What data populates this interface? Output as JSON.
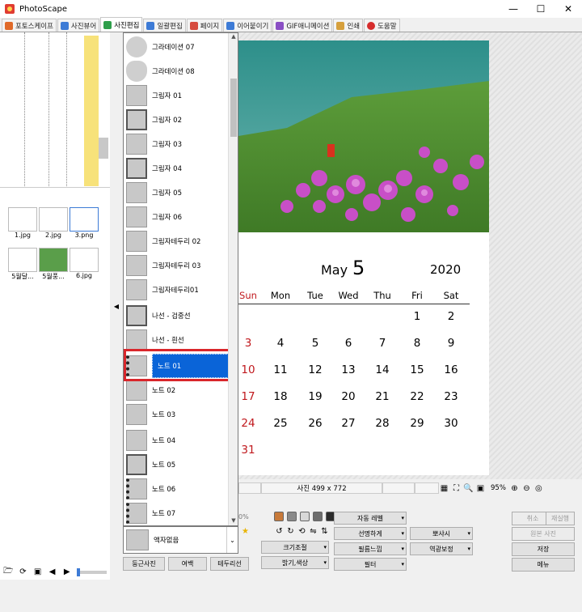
{
  "window": {
    "title": "PhotoScape",
    "minimize": "—",
    "maximize": "☐",
    "close": "✕"
  },
  "tabs": [
    {
      "label": "포토스케이프",
      "color": "#e06a2a"
    },
    {
      "label": "사진뷰어",
      "color": "#3d7bd6"
    },
    {
      "label": "사진편집",
      "color": "#2e9e4a"
    },
    {
      "label": "일괄편집",
      "color": "#3d7bd6"
    },
    {
      "label": "페이지",
      "color": "#d64a3d"
    },
    {
      "label": "이어붙이기",
      "color": "#3d7bd6"
    },
    {
      "label": "GIF애니메이션",
      "color": "#8a4fc4"
    },
    {
      "label": "인쇄",
      "color": "#d6a03d"
    },
    {
      "label": "도움말",
      "color": "#d62d2d"
    }
  ],
  "thumbnails": [
    {
      "name": "1.jpg"
    },
    {
      "name": "2.jpg"
    },
    {
      "name": "3.png"
    },
    {
      "name": "5월달..."
    },
    {
      "name": "5월풍..."
    },
    {
      "name": "6.jpg"
    }
  ],
  "frames": {
    "items": [
      {
        "label": "그라데이션 07",
        "shape": "round"
      },
      {
        "label": "그라데이션 08",
        "shape": "heart"
      },
      {
        "label": "그림자 01",
        "shape": "plain"
      },
      {
        "label": "그림자 02",
        "shape": "dark"
      },
      {
        "label": "그림자 03",
        "shape": "plain"
      },
      {
        "label": "그림자 04",
        "shape": "dark"
      },
      {
        "label": "그림자 05",
        "shape": "plain"
      },
      {
        "label": "그림자 06",
        "shape": "plain"
      },
      {
        "label": "그림자테두리 02",
        "shape": "plain"
      },
      {
        "label": "그림자테두리 03",
        "shape": "plain"
      },
      {
        "label": "그림자테두리01",
        "shape": "plain"
      },
      {
        "label": "나선 - 검중선",
        "shape": "dark"
      },
      {
        "label": "나선 - 흰선",
        "shape": "plain"
      },
      {
        "label": "노트 01",
        "shape": "dots"
      },
      {
        "label": "노트 02",
        "shape": "plain"
      },
      {
        "label": "노트 03",
        "shape": "plain"
      },
      {
        "label": "노트 04",
        "shape": "plain"
      },
      {
        "label": "노트 05",
        "shape": "dark"
      },
      {
        "label": "노트 06",
        "shape": "dots"
      },
      {
        "label": "노트 07",
        "shape": "dots"
      }
    ],
    "selected": "노트 01",
    "current_select": "액자없음",
    "buttons": {
      "round": "둥근사진",
      "margin": "여백",
      "border": "테두리선"
    }
  },
  "calendar": {
    "month": "May",
    "day": "5",
    "year": "2020",
    "weekdays": [
      "Sun",
      "Mon",
      "Tue",
      "Wed",
      "Thu",
      "Fri",
      "Sat"
    ],
    "weeks": [
      [
        "",
        "",
        "",
        "",
        "",
        "1",
        "2"
      ],
      [
        "3",
        "4",
        "5",
        "6",
        "7",
        "8",
        "9"
      ],
      [
        "10",
        "11",
        "12",
        "13",
        "14",
        "15",
        "16"
      ],
      [
        "17",
        "18",
        "19",
        "20",
        "21",
        "22",
        "23"
      ],
      [
        "24",
        "25",
        "26",
        "27",
        "28",
        "29",
        "30"
      ],
      [
        "31",
        "",
        "",
        "",
        "",
        "",
        ""
      ]
    ]
  },
  "status": {
    "photo_size": "사진 499 x 772",
    "zoom": "95%",
    "partial_percent": "0%"
  },
  "tools": {
    "auto_level": "자동 레벨",
    "sharpen": "선명하게",
    "resize": "크기조절",
    "bright_color": "밝기,색상",
    "film_effect": "필름느낌",
    "filter": "필터",
    "bloom": "뽀샤시",
    "backlight": "역광보정",
    "colors": [
      "#c87a3a",
      "#8a8a8a",
      "#d8d8d8",
      "#6e6e6e",
      "#2b2b2b"
    ]
  },
  "actions": {
    "undo": "취소",
    "redo": "재실행",
    "original": "원본 사진",
    "save": "저장",
    "menu": "메뉴"
  }
}
